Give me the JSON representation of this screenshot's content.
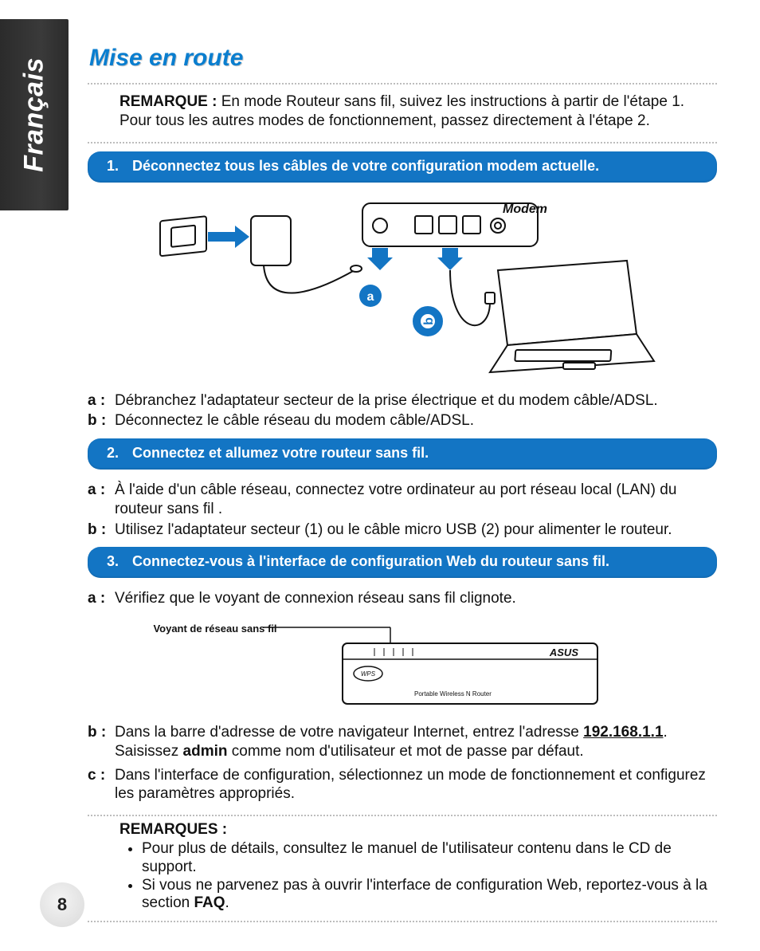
{
  "language_tab": "Français",
  "title": "Mise en route",
  "top_note": {
    "label": "REMARQUE :",
    "text": "En mode Routeur sans fil, suivez les instructions à partir de l'étape 1. Pour tous les autres modes de fonctionnement, passez directement à l'étape 2."
  },
  "steps": [
    {
      "num": "1.",
      "title": "Déconnectez tous les câbles de votre configuration modem actuelle."
    },
    {
      "num": "2.",
      "title": "Connectez et allumez votre routeur sans fil."
    },
    {
      "num": "3.",
      "title": "Connectez-vous à l'interface de configuration Web du routeur sans fil."
    }
  ],
  "diagram1": {
    "modem_label": "Modem",
    "marker_a": "a",
    "marker_b": "b"
  },
  "step1_items": {
    "a": {
      "label": "a :",
      "text": "Débranchez l'adaptateur secteur de la prise électrique et du modem câble/ADSL."
    },
    "b": {
      "label": "b :",
      "text": "Déconnectez le câble réseau du modem câble/ADSL."
    }
  },
  "step2_items": {
    "a": {
      "label": "a :",
      "text": "À l'aide d'un câble réseau, connectez votre ordinateur au port réseau local (LAN) du routeur sans fil ."
    },
    "b": {
      "label": "b :",
      "text": "Utilisez l'adaptateur secteur (1) ou le câble micro USB (2) pour alimenter le routeur."
    }
  },
  "step3_items": {
    "a": {
      "label": "a :",
      "text": "Vérifiez que le voyant de connexion réseau sans fil clignote."
    },
    "b": {
      "label": "b :",
      "pre": "Dans la barre d'adresse de votre navigateur Internet, entrez l'adresse ",
      "ip": "192.168.1.1",
      "mid": ". Saisissez ",
      "admin": "admin",
      "post": " comme nom d'utilisateur et mot de passe par défaut."
    },
    "c": {
      "label": "c :",
      "text": "Dans l'interface de configuration, sélectionnez un mode de fonctionnement et configurez les paramètres appropriés."
    }
  },
  "router_fig": {
    "caption": "Voyant de réseau sans fil",
    "brand": "ASUS",
    "subtitle": "Portable Wireless N Router",
    "wps": "WPS"
  },
  "remarks": {
    "heading": "REMARQUES :",
    "items": [
      "Pour plus de détails, consultez le manuel de l'utilisateur contenu dans le CD de support.",
      "Si vous ne parvenez pas à ouvrir l'interface de configuration Web, reportez-vous à la section "
    ],
    "faq_label": "FAQ"
  },
  "page_number": "8"
}
